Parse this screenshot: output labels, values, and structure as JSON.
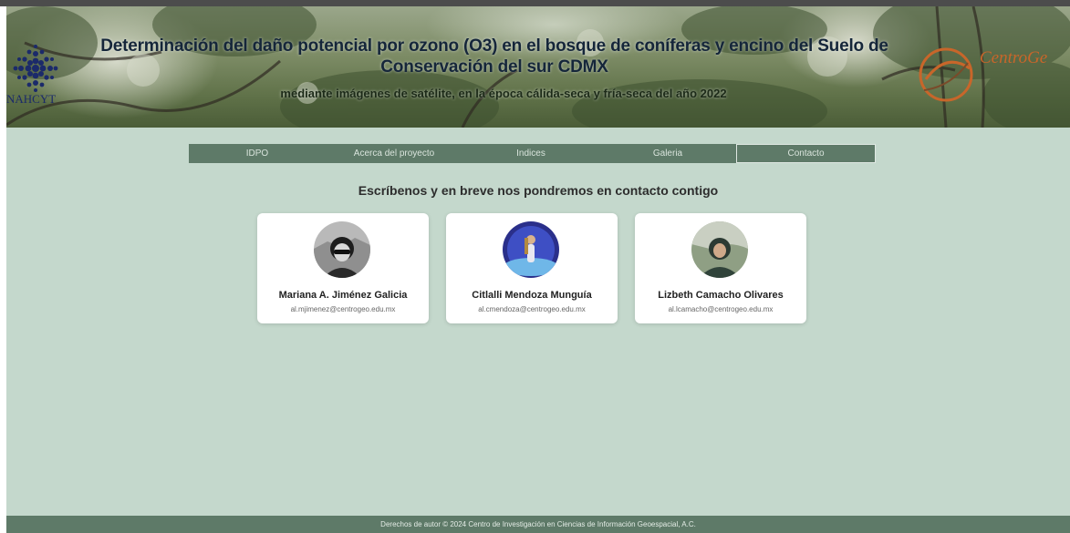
{
  "header": {
    "title": "Determinación del daño potencial por ozono (O3) en el bosque de coníferas y encino del Suelo de Conservación del sur CDMX",
    "subtitle": "mediante imágenes de satélite, en la época cálida-seca y fría-seca del año 2022",
    "logo_left_text": "NAHCYT",
    "logo_right_text": "CentroGe"
  },
  "nav": {
    "items": [
      {
        "label": "IDPO"
      },
      {
        "label": "Acerca del proyecto"
      },
      {
        "label": "Indices"
      },
      {
        "label": "Galeria"
      },
      {
        "label": "Contacto"
      }
    ],
    "active": "Contacto"
  },
  "contact": {
    "heading": "Escríbenos y en breve nos pondremos en contacto contigo",
    "people": [
      {
        "name": "Mariana A. Jiménez Galicia",
        "email": "al.mjimenez@centrogeo.edu.mx"
      },
      {
        "name": "Citlalli Mendoza Munguía",
        "email": "al.cmendoza@centrogeo.edu.mx"
      },
      {
        "name": "Lizbeth Camacho Olivares",
        "email": "al.lcamacho@centrogeo.edu.mx"
      }
    ]
  },
  "footer": {
    "text": "Derechos de autor © 2024 Centro de Investigación en Ciencias de Información Geoespacial, A.C."
  },
  "colors": {
    "page_background": "#c4d8cc",
    "nav_background": "#5e7a68",
    "footer_background": "#5e7a68",
    "card_background": "#ffffff"
  }
}
